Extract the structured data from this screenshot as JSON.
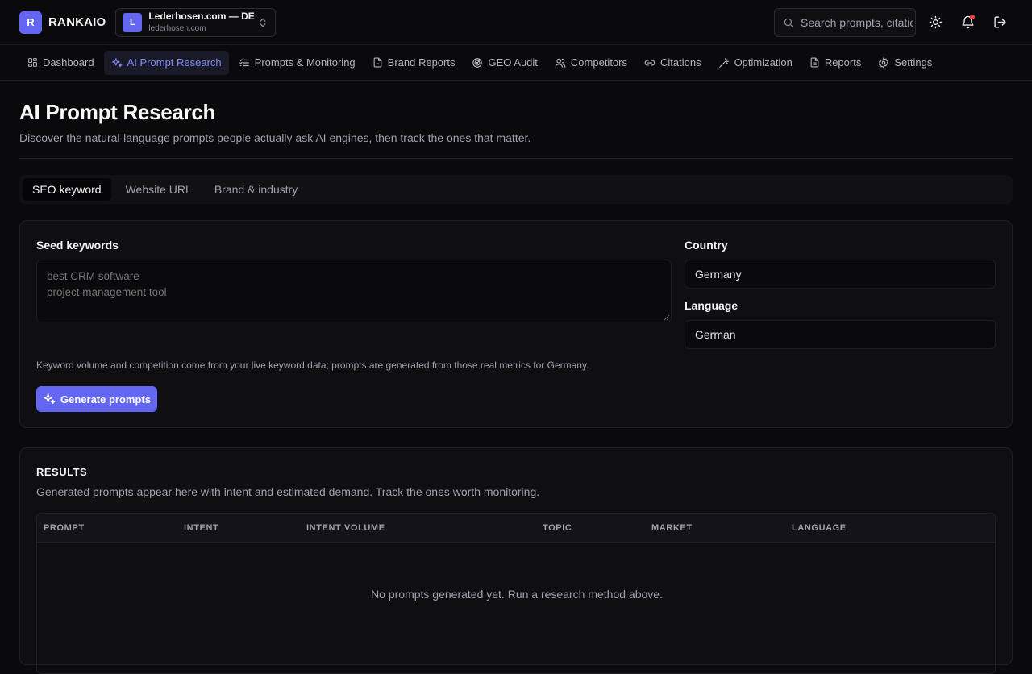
{
  "app": {
    "logo_letter": "R",
    "name": "RANKAIO"
  },
  "project": {
    "avatar_letter": "L",
    "title": "Lederhosen.com — DE",
    "domain": "lederhosen.com"
  },
  "search": {
    "placeholder": "Search prompts, citations…"
  },
  "nav": {
    "items": [
      {
        "label": "Dashboard",
        "icon": "grid-icon",
        "active": false
      },
      {
        "label": "AI Prompt Research",
        "icon": "sparkles-icon",
        "active": true
      },
      {
        "label": "Prompts & Monitoring",
        "icon": "list-check-icon",
        "active": false
      },
      {
        "label": "Brand Reports",
        "icon": "document-icon",
        "active": false
      },
      {
        "label": "GEO Audit",
        "icon": "radar-icon",
        "active": false
      },
      {
        "label": "Competitors",
        "icon": "users-icon",
        "active": false
      },
      {
        "label": "Citations",
        "icon": "link-icon",
        "active": false
      },
      {
        "label": "Optimization",
        "icon": "wand-icon",
        "active": false
      },
      {
        "label": "Reports",
        "icon": "file-text-icon",
        "active": false
      },
      {
        "label": "Settings",
        "icon": "gear-icon",
        "active": false
      }
    ]
  },
  "page": {
    "title": "AI Prompt Research",
    "subtitle": "Discover the natural-language prompts people actually ask AI engines, then track the ones that matter."
  },
  "tabs": [
    {
      "label": "SEO keyword",
      "active": true
    },
    {
      "label": "Website URL",
      "active": false
    },
    {
      "label": "Brand & industry",
      "active": false
    }
  ],
  "form": {
    "seed_label": "Seed keywords",
    "seed_placeholder": "best CRM software\nproject management tool",
    "country_label": "Country",
    "country_value": "Germany",
    "language_label": "Language",
    "language_value": "German",
    "help_text": "Keyword volume and competition come from your live keyword data; prompts are generated from those real metrics for Germany.",
    "submit_label": "Generate prompts"
  },
  "results": {
    "title": "RESULTS",
    "subtitle": "Generated prompts appear here with intent and estimated demand. Track the ones worth monitoring.",
    "columns": [
      "PROMPT",
      "INTENT",
      "INTENT VOLUME",
      "TOPIC",
      "MARKET",
      "LANGUAGE"
    ],
    "empty_message": "No prompts generated yet. Run a research method above."
  },
  "colors": {
    "accent": "#6366f1",
    "accent_text": "#818cf8",
    "background": "#0a0a0c",
    "notification": "#ef4444"
  }
}
